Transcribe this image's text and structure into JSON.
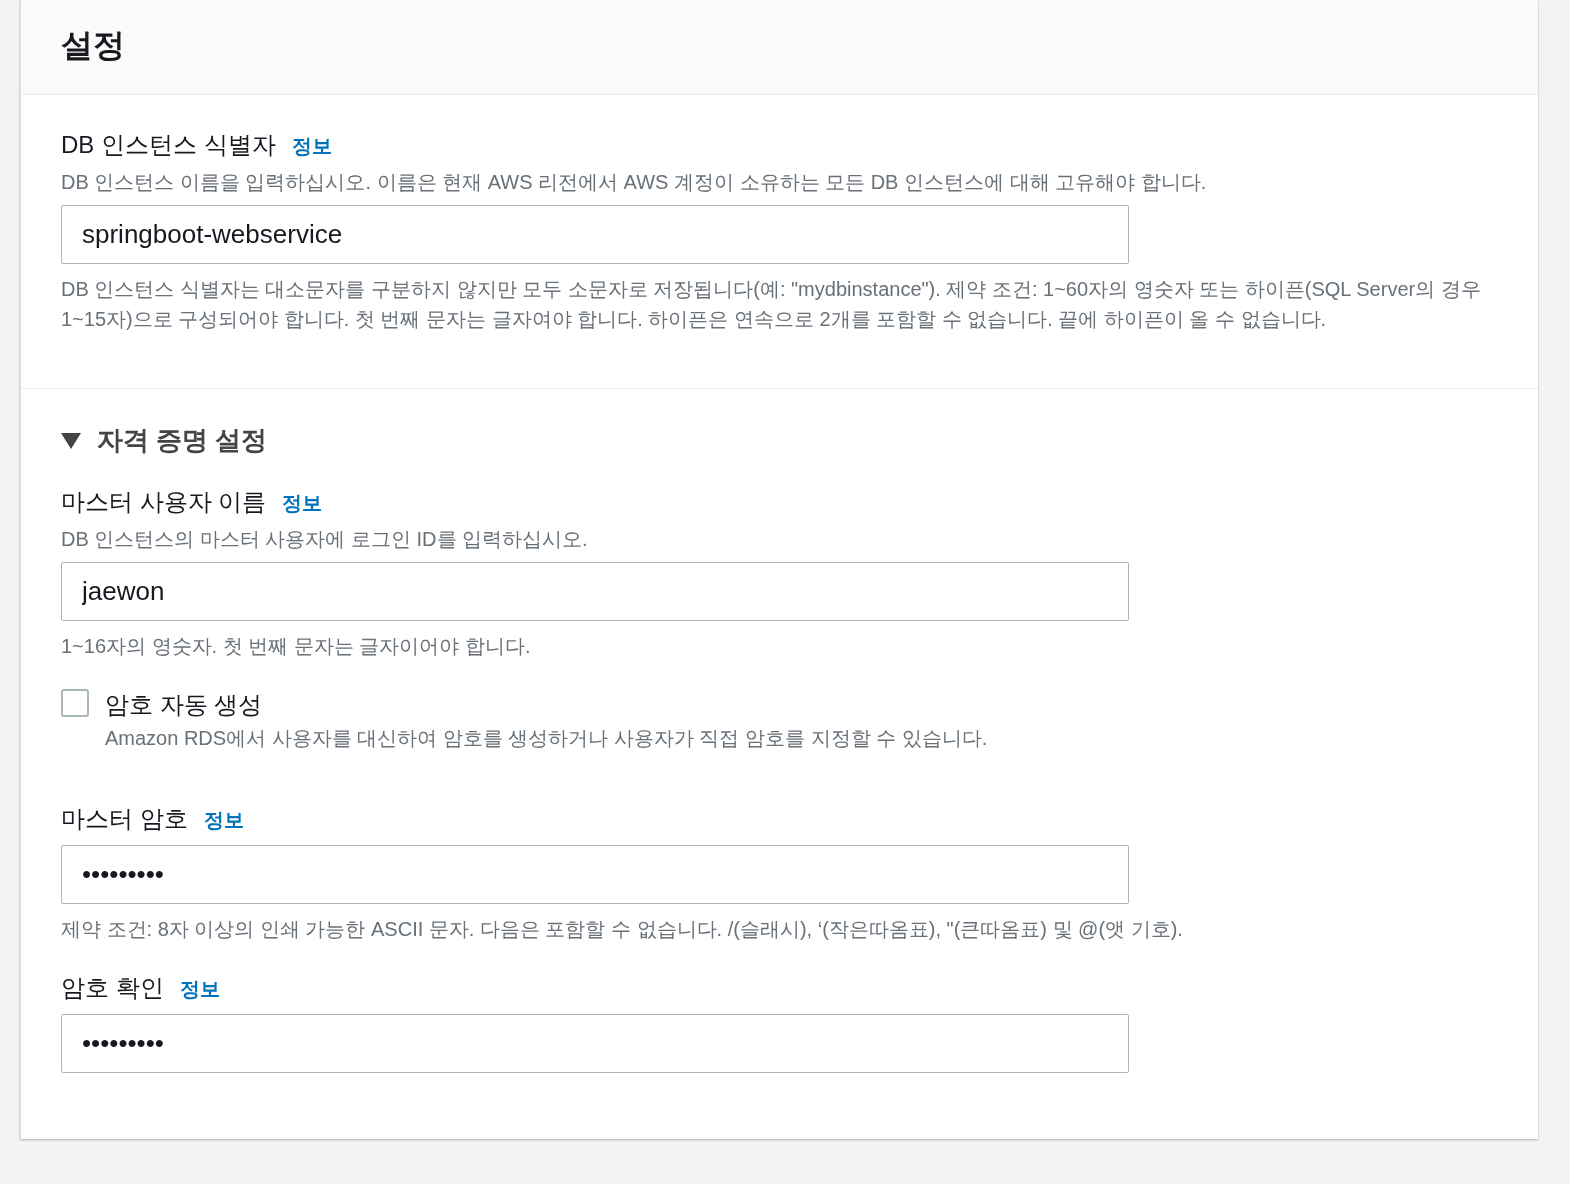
{
  "panel": {
    "title": "설정"
  },
  "sections": [
    {
      "fields": [
        {
          "kind": "text",
          "label": "DB 인스턴스 식별자",
          "info": "정보",
          "description": "DB 인스턴스 이름을 입력하십시오. 이름은 현재 AWS 리전에서 AWS 계정이 소유하는 모든 DB 인스턴스에 대해 고유해야 합니다.",
          "value": "springboot-webservice",
          "hint": "DB 인스턴스 식별자는 대소문자를 구분하지 않지만 모두 소문자로 저장됩니다(예: \"mydbinstance\"). 제약 조건: 1~60자의 영숫자 또는 하이픈(SQL Server의 경우 1~15자)으로 구성되어야 합니다. 첫 번째 문자는 글자여야 합니다. 하이픈은 연속으로 2개를 포함할 수 없습니다. 끝에 하이픈이 올 수 없습니다."
        }
      ]
    },
    {
      "title": "자격 증명 설정",
      "expanded": true,
      "fields": [
        {
          "kind": "text",
          "label": "마스터 사용자 이름",
          "info": "정보",
          "description": "DB 인스턴스의 마스터 사용자에 로그인 ID를 입력하십시오.",
          "value": "jaewon",
          "hint": "1~16자의 영숫자. 첫 번째 문자는 글자이어야 합니다."
        },
        {
          "kind": "checkbox",
          "label": "암호 자동 생성",
          "checked": false,
          "description": "Amazon RDS에서 사용자를 대신하여 암호를 생성하거나 사용자가 직접 암호를 지정할 수 있습니다."
        },
        {
          "kind": "text",
          "label": "마스터 암호",
          "info": "정보",
          "value": "•••••••••",
          "hint": "제약 조건: 8자 이상의 인쇄 가능한 ASCII 문자. 다음은 포함할 수 없습니다. /(슬래시), ‘(작은따옴표), \"(큰따옴표) 및 @(앳 기호)."
        },
        {
          "kind": "text",
          "label": "암호 확인",
          "info": "정보",
          "value": "•••••••••"
        }
      ]
    }
  ]
}
